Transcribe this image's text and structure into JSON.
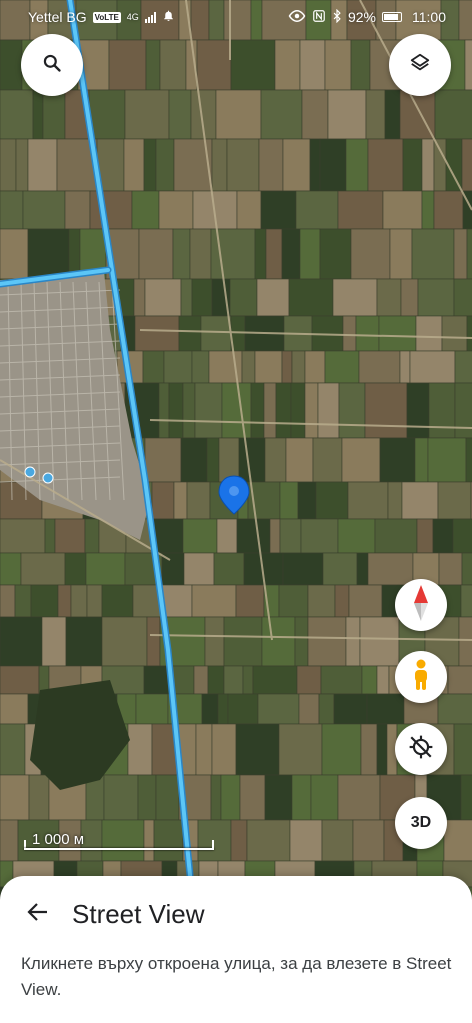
{
  "status_bar": {
    "carrier": "Yettel BG",
    "volte": "VoLTE",
    "network": "4G",
    "battery": "92%",
    "time": "11:00"
  },
  "map": {
    "type": "satellite",
    "scale_label": "1 000 м",
    "colors": {
      "road": "#45b8f2",
      "pin": "#1a73e8"
    }
  },
  "controls": {
    "search": {
      "icon": "search-icon"
    },
    "layers": {
      "icon": "layers-icon"
    },
    "compass": {
      "icon": "compass-icon"
    },
    "pegman": {
      "icon": "pegman-icon"
    },
    "location": {
      "icon": "location-off-icon"
    },
    "three_d": {
      "label": "3D"
    }
  },
  "sheet": {
    "title": "Street View",
    "description": "Кликнете върху откроена улица, за да влезете в Street View."
  }
}
